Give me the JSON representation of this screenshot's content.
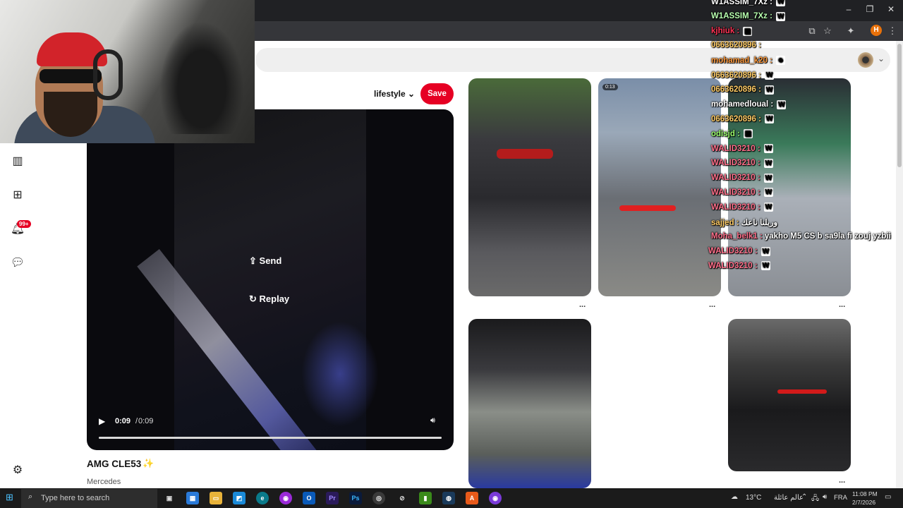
{
  "window": {
    "minimize": "–",
    "restore": "❐",
    "close": "✕"
  },
  "browser": {
    "profile_initial": "H"
  },
  "pin": {
    "board_label": "lifestyle",
    "save_label": "Save",
    "send_label": "Send",
    "replay_label": "Replay",
    "time_current": "0:09",
    "time_separator": "/",
    "time_duration": "0:09",
    "progress": 1.0,
    "title": "AMG CLE53",
    "title_emoji": "✨",
    "subtitle": "Mercedes"
  },
  "sidebar": {
    "notification_count": "99+"
  },
  "grid": {
    "video_badge": "0:13",
    "more_label": "..."
  },
  "chat": [
    {
      "user": "W1ASSIM_7Xz :",
      "msg": "",
      "emote": "W",
      "color": "#ffffff"
    },
    {
      "user": "W1ASSIM_7Xz :",
      "msg": "",
      "emote": "W",
      "color": "#b8ffb0"
    },
    {
      "user": "kjhiuk :",
      "msg": "",
      "emote": "▣",
      "color": "#ff3355"
    },
    {
      "user": "0663620896 :",
      "msg": "",
      "emote": "",
      "color": "#ffcc66"
    },
    {
      "user": "mohamad_k20 :",
      "msg": "",
      "emote": "☻",
      "color": "#ff9a3c"
    },
    {
      "user": "0663620896 :",
      "msg": "",
      "emote": "W",
      "color": "#ffcc66"
    },
    {
      "user": "0663620896 :",
      "msg": "",
      "emote": "W",
      "color": "#ffcc66"
    },
    {
      "user": "mohamedloual :",
      "msg": "",
      "emote": "W",
      "color": "#ffffff"
    },
    {
      "user": "0663620896 :",
      "msg": "",
      "emote": "W",
      "color": "#ffcc66"
    },
    {
      "user": "odisjd :",
      "msg": "",
      "emote": "▣",
      "color": "#9cff6e"
    },
    {
      "user": "WALID3210 :",
      "msg": "",
      "emote": "W",
      "color": "#ff6f8a"
    },
    {
      "user": "WALID3210 :",
      "msg": "",
      "emote": "W",
      "color": "#ff6f8a"
    },
    {
      "user": "WALID3210 :",
      "msg": "",
      "emote": "W",
      "color": "#ff6f8a"
    },
    {
      "user": "WALID3210 :",
      "msg": "",
      "emote": "W",
      "color": "#ff6f8a"
    },
    {
      "user": "WALID3210 :",
      "msg": "",
      "emote": "W",
      "color": "#ff6f8a"
    },
    {
      "user": "sajjed :",
      "msg": "وربلنا ناعك",
      "emote": "",
      "color": "#ffcc66"
    },
    {
      "user": "Moha_belk1 :",
      "msg": "yakho M5 CS b sa9la fi zouj yzbii",
      "emote": "",
      "color": "#ff6f8a"
    },
    {
      "user": "WALID3210 :",
      "msg": "",
      "emote": "W",
      "color": "#ff6f8a"
    },
    {
      "user": "WALID3210 :",
      "msg": "",
      "emote": "W",
      "color": "#ff6f8a"
    }
  ],
  "taskbar": {
    "search_placeholder": "Type here to search",
    "temperature": "13°C",
    "location": "عالم عائلة",
    "language": "FRA",
    "time": "11:08 PM",
    "date": "2/7/2026"
  },
  "colors": {
    "accent": "#e60023",
    "chrome": "#202124",
    "taskbar": "#1b1b1b"
  }
}
